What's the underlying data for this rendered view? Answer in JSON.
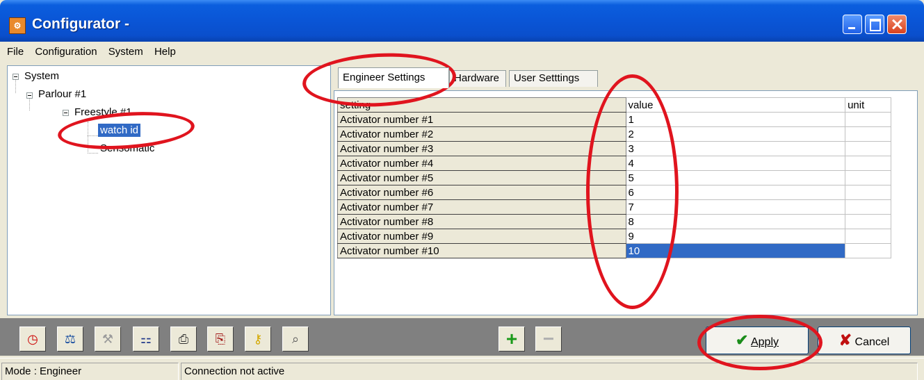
{
  "window": {
    "title": "Configurator -"
  },
  "menu": [
    "File",
    "Configuration",
    "System",
    "Help"
  ],
  "tree": {
    "root": "System",
    "parlour": "Parlour #1",
    "freestyle": "Freestyle #1",
    "watch": "watch id",
    "sensomatic": "Sensomatic"
  },
  "tabs": [
    "Engineer Settings",
    "Hardware",
    "User Setttings"
  ],
  "grid": {
    "headers": {
      "setting": "setting",
      "value": "value",
      "unit": "unit"
    },
    "rows": [
      {
        "setting": "Activator number #1",
        "value": "1",
        "unit": ""
      },
      {
        "setting": "Activator number #2",
        "value": "2",
        "unit": ""
      },
      {
        "setting": "Activator number #3",
        "value": "3",
        "unit": ""
      },
      {
        "setting": "Activator number #4",
        "value": "4",
        "unit": ""
      },
      {
        "setting": "Activator number #5",
        "value": "5",
        "unit": ""
      },
      {
        "setting": "Activator number #6",
        "value": "6",
        "unit": ""
      },
      {
        "setting": "Activator number #7",
        "value": "7",
        "unit": ""
      },
      {
        "setting": "Activator number #8",
        "value": "8",
        "unit": ""
      },
      {
        "setting": "Activator number #9",
        "value": "9",
        "unit": ""
      },
      {
        "setting": "Activator number #10",
        "value": "10",
        "unit": ""
      }
    ]
  },
  "buttons": {
    "apply": "Apply",
    "cancel": "Cancel"
  },
  "status": {
    "mode": "Mode : Engineer",
    "connection": "Connection not active"
  },
  "colors": {
    "titlebar": "#0a55d6",
    "selection": "#316ac5",
    "annotation": "#e0141e"
  }
}
